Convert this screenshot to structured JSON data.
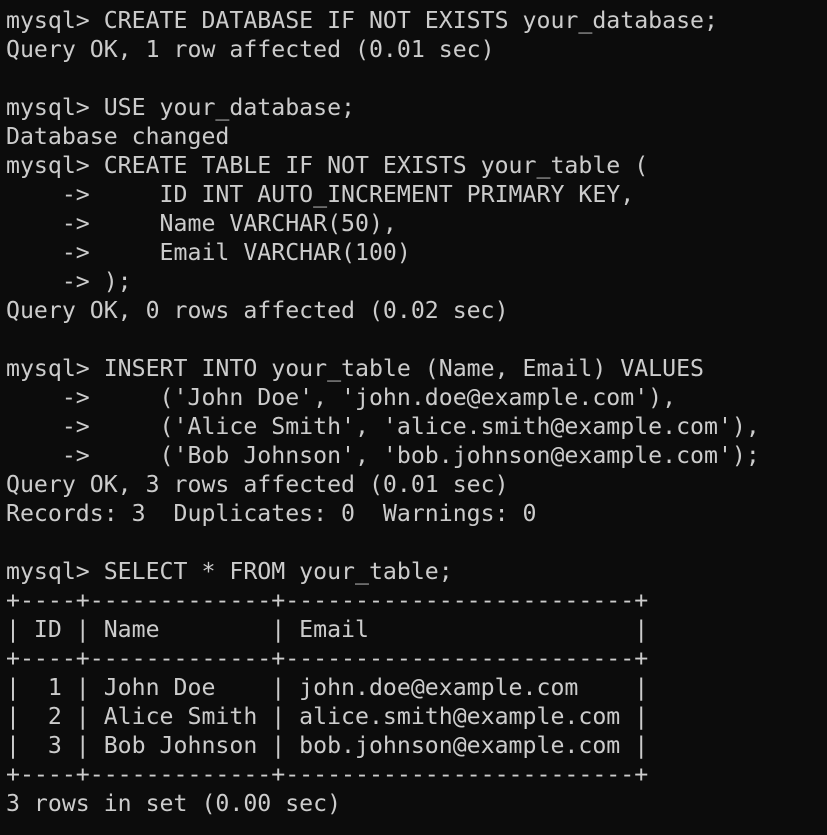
{
  "terminal": {
    "lines": [
      "mysql> CREATE DATABASE IF NOT EXISTS your_database;",
      "Query OK, 1 row affected (0.01 sec)",
      "",
      "mysql> USE your_database;",
      "Database changed",
      "mysql> CREATE TABLE IF NOT EXISTS your_table (",
      "    ->     ID INT AUTO_INCREMENT PRIMARY KEY,",
      "    ->     Name VARCHAR(50),",
      "    ->     Email VARCHAR(100)",
      "    -> );",
      "Query OK, 0 rows affected (0.02 sec)",
      "",
      "mysql> INSERT INTO your_table (Name, Email) VALUES",
      "    ->     ('John Doe', 'john.doe@example.com'),",
      "    ->     ('Alice Smith', 'alice.smith@example.com'),",
      "    ->     ('Bob Johnson', 'bob.johnson@example.com');",
      "Query OK, 3 rows affected (0.01 sec)",
      "Records: 3  Duplicates: 0  Warnings: 0",
      "",
      "mysql> SELECT * FROM your_table;",
      "+----+-------------+-------------------------+",
      "| ID | Name        | Email                   |",
      "+----+-------------+-------------------------+",
      "|  1 | John Doe    | john.doe@example.com    |",
      "|  2 | Alice Smith | alice.smith@example.com |",
      "|  3 | Bob Johnson | bob.johnson@example.com |",
      "+----+-------------+-------------------------+",
      "3 rows in set (0.00 sec)"
    ]
  },
  "colors": {
    "background": "#0c0c0c",
    "foreground": "#cccccc"
  }
}
